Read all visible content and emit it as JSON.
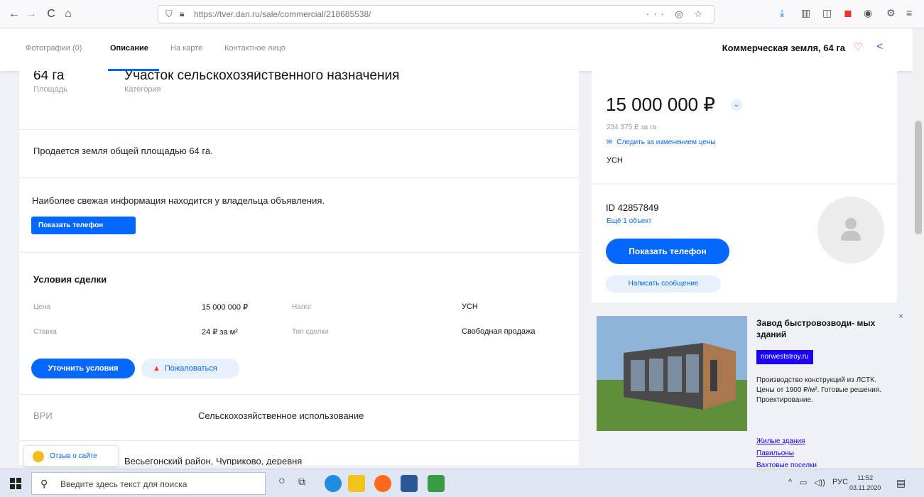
{
  "browser": {
    "url": "https://tver.dan.ru/sale/commercial/218685538/",
    "back": "←",
    "forward": "→",
    "reload": "C",
    "home": "⌂",
    "page_actions": "··· ◎ ☆"
  },
  "page_nav": {
    "tabs": [
      "Фотографии (0)",
      "Описание",
      "На карте",
      "Контактное лицо"
    ],
    "active_tab_index": 1,
    "title": "Коммерческая земля, 64 га"
  },
  "summary": {
    "area_value": "64 га",
    "area_label": "Площадь",
    "category_value": "Участок сельскохозяйственного назначения",
    "category_label": "Категория"
  },
  "description": "Продается земля общей площадью 64 га.",
  "owner_info": {
    "text": "Наиболее свежая информация находится у владельца объявления.",
    "show_phone": "Показать телефон"
  },
  "deal": {
    "title": "Условия сделки",
    "price_label": "Цена",
    "price_value": "15 000 000 ₽",
    "tax_label": "Налог",
    "tax_value": "УСН",
    "rate_label": "Ставка",
    "rate_value": "24 ₽ за м²",
    "deal_type_label": "Тип сделки",
    "deal_type_value": "Свободная продажа",
    "clarify_button": "Уточнить условия",
    "complain_button": "Пожаловаться"
  },
  "vri": {
    "label": "ВРИ",
    "value": "Сельскохозяйственное использование"
  },
  "address_partial": "Весьегонский район, Чуприково, деревня",
  "feedback_label": "Отзыв о сайте",
  "price_card": {
    "price": "15 000 000 ₽",
    "per_unit": "234 375 ₽ за га",
    "watch_price": "Следить за изменением цены",
    "tax": "УСН"
  },
  "seller": {
    "id": "ID 42857849",
    "more_objects": "Ещё 1 объект",
    "show_phone": "Показать телефон",
    "write_message": "Написать сообщение"
  },
  "ad": {
    "title": "Завод быстровозводи- мых зданий",
    "domain": "norweststroy.ru",
    "text": "Производство конструкций из ЛСТК. Цены от 1900 ₽/м². Готовые решения. Проектирование.",
    "links": [
      "Жилые здания",
      "Павильоны",
      "Вахтовые поселки"
    ],
    "close": "×"
  },
  "taskbar": {
    "search_placeholder": "Введите здесь текст для поиска",
    "language": "РУС",
    "time": "11:52",
    "date": "03.11.2020"
  },
  "colors": {
    "accent": "#0468ff",
    "accent_light": "#e8f0fb",
    "page_bg": "#f0f1f5",
    "warning": "#ff3b30",
    "ad_link": "#1a00ff"
  }
}
